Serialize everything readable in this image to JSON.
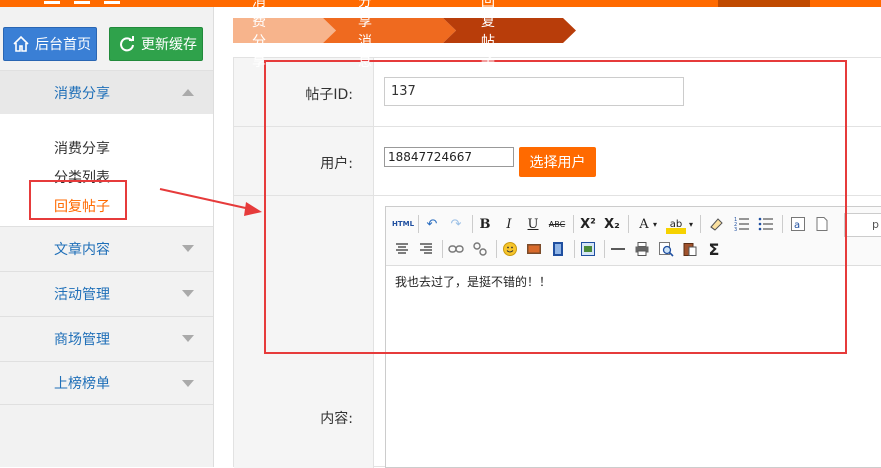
{
  "sidebar": {
    "home_button": "后台首页",
    "refresh_button": "更新缓存",
    "sections": [
      {
        "label": "消费分享",
        "expanded": true
      },
      {
        "label": "文章内容",
        "expanded": false
      },
      {
        "label": "活动管理",
        "expanded": false
      },
      {
        "label": "商场管理",
        "expanded": false
      },
      {
        "label": "上榜榜单",
        "expanded": false
      }
    ],
    "sub_items": [
      "消费分享",
      "分类列表",
      "回复帖子"
    ],
    "active_sub_item": "回复帖子"
  },
  "breadcrumb": [
    "消费分享",
    "分享消息",
    "回复帖子"
  ],
  "form": {
    "post_id_label": "帖子ID:",
    "post_id_value": "137",
    "user_label": "用户:",
    "user_value": "18847724667",
    "select_user_button": "选择用户",
    "content_label": "内容:"
  },
  "editor": {
    "html_button": "HTML",
    "font_size_partial": "p",
    "content": "我也去过了，是挺不错的！！"
  },
  "colors": {
    "accent": "#ff6a00",
    "breadcrumb_light": "#f7b48c",
    "breadcrumb_mid": "#ef6a1f",
    "breadcrumb_dark": "#b83d0a",
    "home_button": "#3a7fd5",
    "refresh_button": "#2fa24b",
    "annotation": "#e63b3b"
  }
}
